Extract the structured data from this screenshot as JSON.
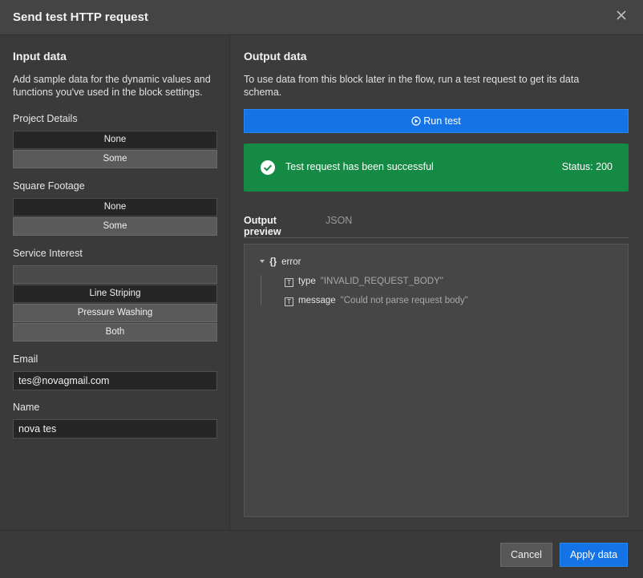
{
  "dialog": {
    "title": "Send test HTTP request"
  },
  "input_panel": {
    "title": "Input data",
    "description": "Add sample data for the dynamic values and functions you've used in the block settings.",
    "project_details": {
      "label": "Project Details",
      "options": [
        "None",
        "Some"
      ]
    },
    "square_footage": {
      "label": "Square Footage",
      "options": [
        "None",
        "Some"
      ]
    },
    "service_interest": {
      "label": "Service Interest",
      "options": [
        "",
        "Line Striping",
        "Pressure Washing",
        "Both"
      ]
    },
    "email": {
      "label": "Email",
      "value": "tes@novagmail.com"
    },
    "name": {
      "label": "Name",
      "value": "nova tes"
    }
  },
  "output_panel": {
    "title": "Output data",
    "description": "To use data from this block later in the flow, run a test request to get its data schema.",
    "run_button": "Run test",
    "result": {
      "message": "Test request has been successful",
      "status": "Status: 200"
    },
    "tabs": [
      "Output preview",
      "JSON"
    ],
    "tree": {
      "root": "error",
      "rows": [
        {
          "key": "type",
          "value": "\"INVALID_REQUEST_BODY\""
        },
        {
          "key": "message",
          "value": "\"Could not parse request body\""
        }
      ]
    }
  },
  "footer": {
    "cancel": "Cancel",
    "apply": "Apply data"
  },
  "colors": {
    "accent": "#1473e6",
    "success": "#158a45",
    "background": "#3c3c3c"
  }
}
